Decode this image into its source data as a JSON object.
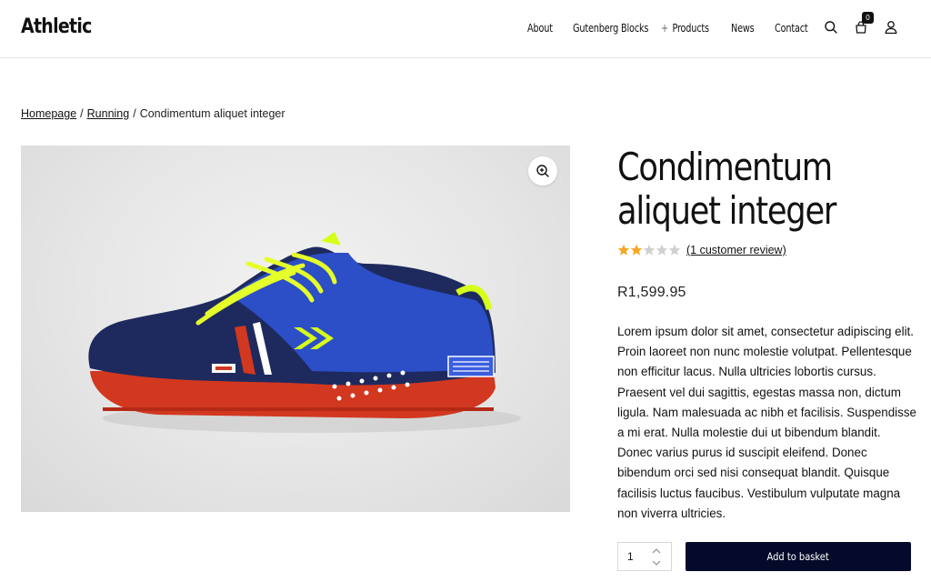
{
  "header": {
    "logo": "Athletic",
    "nav": [
      {
        "label": "About"
      },
      {
        "label": "Gutenberg Blocks"
      },
      {
        "label": "Products",
        "has_plus": true
      },
      {
        "label": "News"
      },
      {
        "label": "Contact"
      }
    ],
    "cart_count": "0",
    "icons": [
      "search-icon",
      "bag-icon",
      "user-icon"
    ]
  },
  "breadcrumb": {
    "home": "Homepage",
    "category": "Running",
    "separator": "/",
    "current": "Condimentum aliquet integer"
  },
  "product": {
    "title": "Condimentum aliquet integer",
    "rating": 2,
    "rating_max": 5,
    "review_link": "(1 customer review)",
    "price": "R1,599.95",
    "description": "Lorem ipsum dolor sit amet, consectetur adipiscing elit. Proin laoreet non nunc molestie volutpat. Pellentesque non efficitur lacus. Nulla ultricies lobortis cursus. Praesent vel dui sagittis, egestas massa non, dictum ligula. Nam malesuada ac nibh et facilisis. Suspendisse a mi erat. Nulla molestie dui ut bibendum blandit. Donec varius purus id suscipit eleifend. Donec bibendum orci sed nisi consequat blandit. Quisque facilisis luctus faucibus. Vestibulum vulputate magna non viverra ultricies.",
    "image_icon": "zoom-in-icon",
    "shoe_brand_text": "hummel"
  },
  "cart_form": {
    "quantity": "1",
    "add_button": "Add to basket"
  },
  "colors": {
    "button_bg": "#050a2a",
    "star_filled": "#f5a623",
    "star_empty": "#cccccc"
  }
}
